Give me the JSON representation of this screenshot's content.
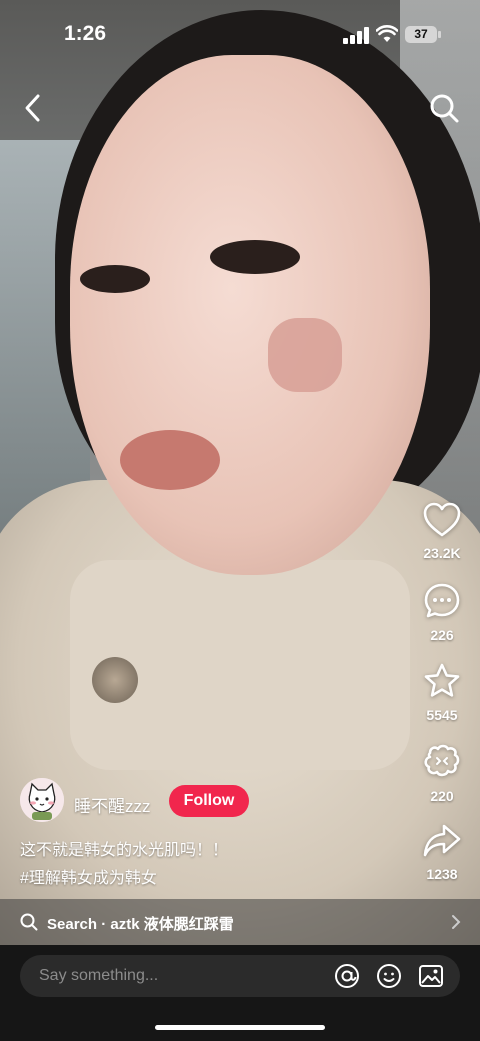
{
  "status_bar": {
    "time": "1:26",
    "battery": "37"
  },
  "author": {
    "name": "睡不醒zzz",
    "follow_label": "Follow"
  },
  "post": {
    "caption": "这不就是韩女的水光肌吗！！",
    "hashtag": "#理解韩女成为韩女"
  },
  "actions": {
    "likes": "23.2K",
    "comments": "226",
    "favorites": "5545",
    "shares_cloud": "220",
    "shares": "1238"
  },
  "search_bar": {
    "text": "Search · aztk 液体腮红踩雷"
  },
  "comment_bar": {
    "placeholder": "Say something..."
  },
  "colors": {
    "follow": "#f1264d",
    "bottom_bar": "#161616"
  }
}
